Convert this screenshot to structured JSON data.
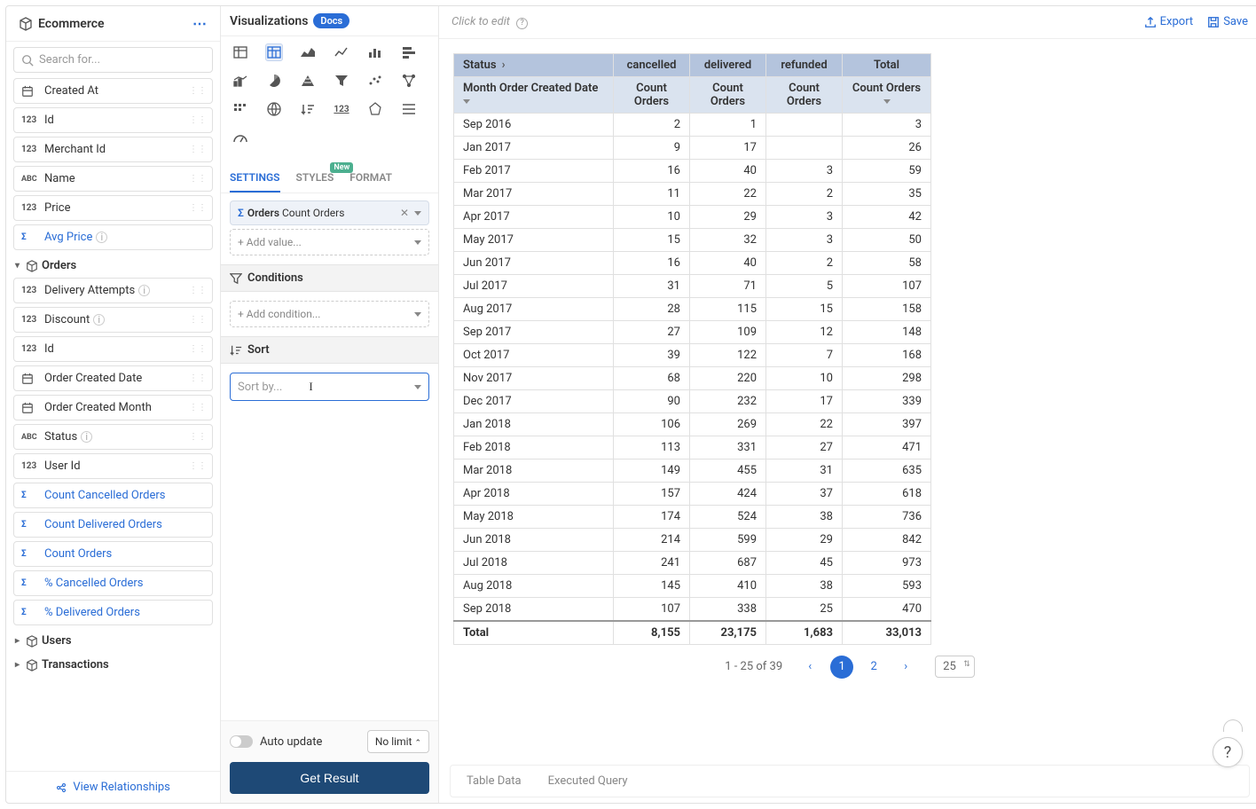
{
  "sidebar": {
    "title": "Ecommerce",
    "search_placeholder": "Search for...",
    "view_relationships": "View Relationships",
    "top_fields": [
      {
        "icon": "date",
        "label": "Created At"
      },
      {
        "icon": "123",
        "label": "Id"
      },
      {
        "icon": "123",
        "label": "Merchant Id"
      },
      {
        "icon": "abc",
        "label": "Name"
      },
      {
        "icon": "123",
        "label": "Price"
      }
    ],
    "top_measure": {
      "label": "Avg Price"
    },
    "orders_group": "Orders",
    "orders_fields": [
      {
        "icon": "123",
        "label": "Delivery Attempts",
        "info": true
      },
      {
        "icon": "123",
        "label": "Discount",
        "info": true
      },
      {
        "icon": "123",
        "label": "Id"
      },
      {
        "icon": "date",
        "label": "Order Created Date"
      },
      {
        "icon": "date",
        "label": "Order Created Month"
      },
      {
        "icon": "abc",
        "label": "Status",
        "info": true
      },
      {
        "icon": "123",
        "label": "User Id"
      }
    ],
    "orders_measures": [
      "Count Cancelled Orders",
      "Count Delivered Orders",
      "Count Orders",
      "% Cancelled Orders",
      "% Delivered Orders"
    ],
    "users_group": "Users",
    "transactions_group": "Transactions"
  },
  "viz": {
    "title": "Visualizations",
    "docs": "Docs",
    "tabs": {
      "settings": "SETTINGS",
      "styles": "STYLES",
      "format": "FORMAT",
      "new": "New"
    },
    "value_entity": "Orders",
    "value_field": "Count Orders",
    "add_value": "+ Add value...",
    "conditions_label": "Conditions",
    "add_condition": "+ Add condition...",
    "sort_label": "Sort",
    "sort_placeholder": "Sort by...",
    "auto_update": "Auto update",
    "no_limit": "No limit",
    "get_result": "Get Result"
  },
  "main": {
    "click_to_edit": "Click to edit",
    "export": "Export",
    "save": "Save",
    "status_header": "Status",
    "month_header": "Month Order Created Date",
    "cols": [
      "cancelled",
      "delivered",
      "refunded"
    ],
    "total_col": "Total",
    "sub_header": "Count Orders",
    "total_row_label": "Total"
  },
  "chart_data": {
    "type": "table",
    "row_dimension": "Month Order Created Date",
    "col_dimension": "Status",
    "measure": "Count Orders",
    "columns": [
      "cancelled",
      "delivered",
      "refunded",
      "Total"
    ],
    "rows": [
      {
        "label": "Sep 2016",
        "values": [
          2,
          1,
          null,
          3
        ]
      },
      {
        "label": "Jan 2017",
        "values": [
          9,
          17,
          null,
          26
        ]
      },
      {
        "label": "Feb 2017",
        "values": [
          16,
          40,
          3,
          59
        ]
      },
      {
        "label": "Mar 2017",
        "values": [
          11,
          22,
          2,
          35
        ]
      },
      {
        "label": "Apr 2017",
        "values": [
          10,
          29,
          3,
          42
        ]
      },
      {
        "label": "May 2017",
        "values": [
          15,
          32,
          3,
          50
        ]
      },
      {
        "label": "Jun 2017",
        "values": [
          16,
          40,
          2,
          58
        ]
      },
      {
        "label": "Jul 2017",
        "values": [
          31,
          71,
          5,
          107
        ]
      },
      {
        "label": "Aug 2017",
        "values": [
          28,
          115,
          15,
          158
        ]
      },
      {
        "label": "Sep 2017",
        "values": [
          27,
          109,
          12,
          148
        ]
      },
      {
        "label": "Oct 2017",
        "values": [
          39,
          122,
          7,
          168
        ]
      },
      {
        "label": "Nov 2017",
        "values": [
          68,
          220,
          10,
          298
        ]
      },
      {
        "label": "Dec 2017",
        "values": [
          90,
          232,
          17,
          339
        ]
      },
      {
        "label": "Jan 2018",
        "values": [
          106,
          269,
          22,
          397
        ]
      },
      {
        "label": "Feb 2018",
        "values": [
          113,
          331,
          27,
          471
        ]
      },
      {
        "label": "Mar 2018",
        "values": [
          149,
          455,
          31,
          635
        ]
      },
      {
        "label": "Apr 2018",
        "values": [
          157,
          424,
          37,
          618
        ]
      },
      {
        "label": "May 2018",
        "values": [
          174,
          524,
          38,
          736
        ]
      },
      {
        "label": "Jun 2018",
        "values": [
          214,
          599,
          29,
          842
        ]
      },
      {
        "label": "Jul 2018",
        "values": [
          241,
          687,
          45,
          973
        ]
      },
      {
        "label": "Aug 2018",
        "values": [
          145,
          410,
          38,
          593
        ]
      },
      {
        "label": "Sep 2018",
        "values": [
          107,
          338,
          25,
          470
        ]
      }
    ],
    "totals": [
      "8,155",
      "23,175",
      "1,683",
      "33,013"
    ]
  },
  "pagination": {
    "info": "1 - 25 of 39",
    "pages": [
      "1",
      "2"
    ],
    "active": 0,
    "size": "25"
  },
  "bottom": {
    "table_data": "Table Data",
    "executed_query": "Executed Query"
  }
}
